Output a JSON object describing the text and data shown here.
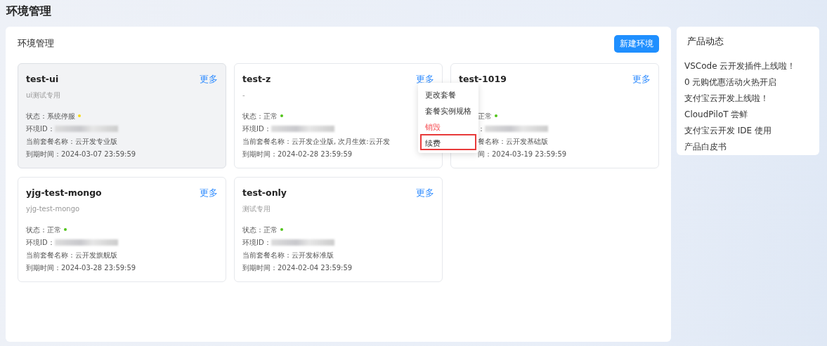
{
  "page_title": "环境管理",
  "panel": {
    "title": "环境管理",
    "create_button": "新建环境"
  },
  "environments": [
    {
      "name": "test-ui",
      "description": "ui测试专用",
      "inactive": true,
      "covered_by_menu": false,
      "more": "更多",
      "status_label": "状态：",
      "status": "系统停服",
      "color": "#fadb14",
      "id_label": "环境ID：",
      "plan_label": "当前套餐名称：",
      "plan": "云开发专业版",
      "expiry_label": "到期时间：",
      "expiry": "2024-03-07 23:59:59"
    },
    {
      "name": "test-z",
      "description": "-",
      "inactive": false,
      "covered_by_menu": false,
      "more": "更多",
      "status_label": "状态：",
      "status": "正常",
      "color": "#52c41a",
      "id_label": "环境ID：",
      "plan_label": "当前套餐名称：",
      "plan": "云开发企业版, 次月生效:云开发",
      "expiry_label": "到期时间：",
      "expiry": "2024-02-28 23:59:59"
    },
    {
      "name": "test-1019",
      "inactive": false,
      "covered_by_menu": true,
      "more": "更多",
      "status": "正常",
      "color": "#52c41a",
      "id_label": "：",
      "plan_label": "餐名称：",
      "plan": "云开发基础版",
      "expiry_label": "间：",
      "expiry": "2024-03-19 23:59:59"
    },
    {
      "name": "yjg-test-mongo",
      "description": "yjg-test-mongo",
      "inactive": false,
      "covered_by_menu": false,
      "more": "更多",
      "status_label": "状态：",
      "status": "正常",
      "color": "#52c41a",
      "id_label": "环境ID：",
      "plan_label": "当前套餐名称：",
      "plan": "云开发旗舰版",
      "expiry_label": "到期时间：",
      "expiry": "2024-03-28 23:59:59"
    },
    {
      "name": "test-only",
      "description": "测试专用",
      "inactive": false,
      "covered_by_menu": false,
      "more": "更多",
      "status_label": "状态：",
      "status": "正常",
      "color": "#52c41a",
      "id_label": "环境ID：",
      "plan_label": "当前套餐名称：",
      "plan": "云开发标准版",
      "expiry_label": "到期时间：",
      "expiry": "2024-02-04 23:59:59"
    }
  ],
  "more_menu": [
    {
      "label": "更改套餐",
      "kind": "normal",
      "highlighted": false
    },
    {
      "label": "套餐实例规格",
      "kind": "normal",
      "highlighted": false
    },
    {
      "label": "销毁",
      "kind": "danger",
      "highlighted": false
    },
    {
      "label": "续费",
      "kind": "normal",
      "highlighted": true
    }
  ],
  "news": {
    "title": "产品动态",
    "items": [
      "VSCode 云开发插件上线啦！",
      "0 元购优惠活动火热开启",
      "支付宝云开发上线啦！",
      "CloudPiloT 尝鲜",
      "支付宝云开发 IDE 使用",
      "产品白皮书"
    ]
  }
}
